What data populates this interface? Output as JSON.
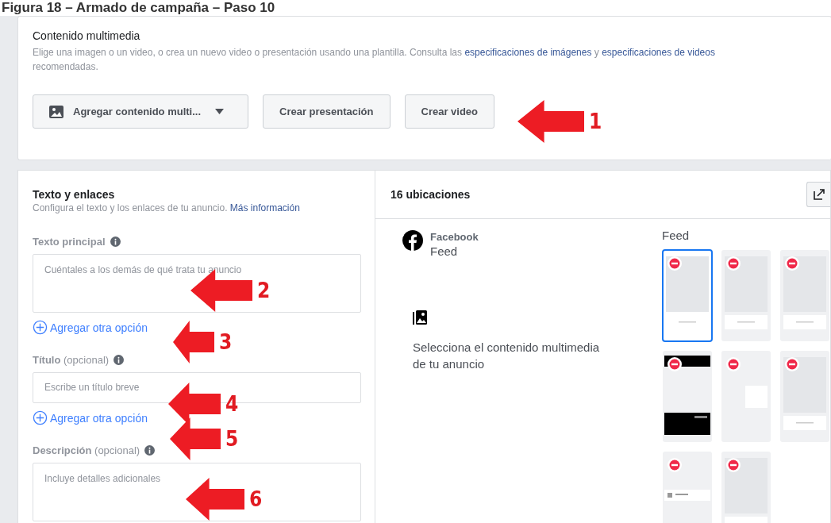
{
  "figure_caption": "Figura 18 – Armado de campaña – Paso 10",
  "media": {
    "title": "Contenido multimedia",
    "description_parts": [
      "Elige una imagen o un video, o crea un nuevo video o presentación usando una plantilla. Consulta las ",
      "especificaciones de imágenes",
      " y ",
      "especificaciones de videos",
      " recomendadas."
    ],
    "buttons": [
      {
        "kind": "dropdown",
        "label": "Agregar contenido multi..."
      },
      {
        "kind": "plain",
        "label": "Crear presentación"
      },
      {
        "kind": "plain",
        "label": "Crear video"
      }
    ]
  },
  "text_links": {
    "title": "Texto y enlaces",
    "subtitle": "Configura el texto y los enlaces de tu anuncio.",
    "link": "Más información",
    "fields": [
      {
        "kind": "textarea",
        "label": "Texto principal",
        "placeholder": "Cuéntales a los demás de qué trata tu anuncio",
        "add_option": "Agregar otra opción"
      },
      {
        "kind": "input",
        "label": "Título",
        "optional": "(opcional)",
        "placeholder": "Escribe un título breve",
        "add_option": "Agregar otra opción"
      },
      {
        "kind": "textarea",
        "label": "Descripción",
        "optional": "(opcional)",
        "placeholder": "Incluye detalles adicionales"
      }
    ]
  },
  "preview": {
    "title": "16 ubicaciones",
    "platform": "Facebook",
    "placement": "Feed",
    "message": "Selecciona el contenido multimedia de tu anuncio",
    "grid_title": "Feed",
    "thumbnails": [
      {
        "selected": true,
        "kind": "post"
      },
      {
        "selected": false,
        "kind": "post"
      },
      {
        "selected": false,
        "kind": "post"
      },
      {
        "selected": false,
        "kind": "dark"
      },
      {
        "selected": false,
        "kind": "side"
      },
      {
        "selected": false,
        "kind": "post"
      },
      {
        "selected": false,
        "kind": "list"
      },
      {
        "selected": false,
        "kind": "post"
      }
    ]
  },
  "annotations": [
    {
      "label": "1"
    },
    {
      "label": "2"
    },
    {
      "label": "3"
    },
    {
      "label": "4"
    },
    {
      "label": "5"
    },
    {
      "label": "6"
    }
  ]
}
